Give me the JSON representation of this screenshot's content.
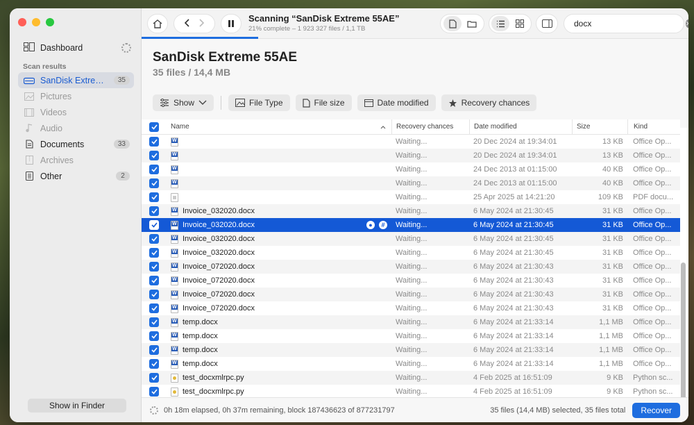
{
  "sidebar": {
    "dashboard_label": "Dashboard",
    "section_label": "Scan results",
    "items": [
      {
        "label": "SanDisk Extreme 5...",
        "count": "35",
        "icon": "drive-icon",
        "state": "active"
      },
      {
        "label": "Pictures",
        "count": "",
        "icon": "picture-icon",
        "state": "dim"
      },
      {
        "label": "Videos",
        "count": "",
        "icon": "video-icon",
        "state": "dim"
      },
      {
        "label": "Audio",
        "count": "",
        "icon": "music-icon",
        "state": "dim"
      },
      {
        "label": "Documents",
        "count": "33",
        "icon": "document-icon",
        "state": "normal"
      },
      {
        "label": "Archives",
        "count": "",
        "icon": "archive-icon",
        "state": "dim"
      },
      {
        "label": "Other",
        "count": "2",
        "icon": "other-file-icon",
        "state": "normal"
      }
    ],
    "finder_button": "Show in Finder"
  },
  "toolbar": {
    "scan_title": "Scanning “SanDisk Extreme 55AE”",
    "scan_subtitle": "21% complete – 1 923 327 files / 1,1 TB",
    "progress": 0.21,
    "search_value": "docx"
  },
  "header": {
    "title": "SanDisk Extreme 55AE",
    "subtitle": "35 files / 14,4 MB",
    "filters": {
      "show": "Show",
      "file_type": "File Type",
      "file_size": "File size",
      "date_modified": "Date modified",
      "recovery": "Recovery chances"
    }
  },
  "table": {
    "columns": {
      "name": "Name",
      "recovery": "Recovery chances",
      "date": "Date modified",
      "size": "Size",
      "kind": "Kind"
    },
    "rows": [
      {
        "name": "",
        "recovery": "Waiting...",
        "date": "20 Dec 2024 at 19:34:01",
        "size": "13 KB",
        "kind": "Office Op...",
        "icon": "w"
      },
      {
        "name": "",
        "recovery": "Waiting...",
        "date": "20 Dec 2024 at 19:34:01",
        "size": "13 KB",
        "kind": "Office Op...",
        "icon": "w"
      },
      {
        "name": "",
        "recovery": "Waiting...",
        "date": "24 Dec 2013 at 01:15:00",
        "size": "40 KB",
        "kind": "Office Op...",
        "icon": "w"
      },
      {
        "name": "",
        "recovery": "Waiting...",
        "date": "24 Dec 2013 at 01:15:00",
        "size": "40 KB",
        "kind": "Office Op...",
        "icon": "w"
      },
      {
        "name": "",
        "recovery": "Waiting...",
        "date": "25 Apr 2025 at 14:21:20",
        "size": "109 KB",
        "kind": "PDF docu...",
        "icon": "f"
      },
      {
        "name": "Invoice_032020.docx",
        "recovery": "Waiting...",
        "date": "6 May 2024 at 21:30:45",
        "size": "31 KB",
        "kind": "Office Op...",
        "icon": "w"
      },
      {
        "name": "Invoice_032020.docx",
        "recovery": "Waiting...",
        "date": "6 May 2024 at 21:30:45",
        "size": "31 KB",
        "kind": "Office Op...",
        "icon": "w",
        "selected": true
      },
      {
        "name": "Invoice_032020.docx",
        "recovery": "Waiting...",
        "date": "6 May 2024 at 21:30:45",
        "size": "31 KB",
        "kind": "Office Op...",
        "icon": "w"
      },
      {
        "name": "Invoice_032020.docx",
        "recovery": "Waiting...",
        "date": "6 May 2024 at 21:30:45",
        "size": "31 KB",
        "kind": "Office Op...",
        "icon": "w"
      },
      {
        "name": "Invoice_072020.docx",
        "recovery": "Waiting...",
        "date": "6 May 2024 at 21:30:43",
        "size": "31 KB",
        "kind": "Office Op...",
        "icon": "w"
      },
      {
        "name": "Invoice_072020.docx",
        "recovery": "Waiting...",
        "date": "6 May 2024 at 21:30:43",
        "size": "31 KB",
        "kind": "Office Op...",
        "icon": "w"
      },
      {
        "name": "Invoice_072020.docx",
        "recovery": "Waiting...",
        "date": "6 May 2024 at 21:30:43",
        "size": "31 KB",
        "kind": "Office Op...",
        "icon": "w"
      },
      {
        "name": "Invoice_072020.docx",
        "recovery": "Waiting...",
        "date": "6 May 2024 at 21:30:43",
        "size": "31 KB",
        "kind": "Office Op...",
        "icon": "w"
      },
      {
        "name": "temp.docx",
        "recovery": "Waiting...",
        "date": "6 May 2024 at 21:33:14",
        "size": "1,1 MB",
        "kind": "Office Op...",
        "icon": "w"
      },
      {
        "name": "temp.docx",
        "recovery": "Waiting...",
        "date": "6 May 2024 at 21:33:14",
        "size": "1,1 MB",
        "kind": "Office Op...",
        "icon": "w"
      },
      {
        "name": "temp.docx",
        "recovery": "Waiting...",
        "date": "6 May 2024 at 21:33:14",
        "size": "1,1 MB",
        "kind": "Office Op...",
        "icon": "w"
      },
      {
        "name": "temp.docx",
        "recovery": "Waiting...",
        "date": "6 May 2024 at 21:33:14",
        "size": "1,1 MB",
        "kind": "Office Op...",
        "icon": "w"
      },
      {
        "name": "test_docxmlrpc.py",
        "recovery": "Waiting...",
        "date": "4 Feb 2025 at 16:51:09",
        "size": "9 KB",
        "kind": "Python sc...",
        "icon": "p"
      },
      {
        "name": "test_docxmlrpc.py",
        "recovery": "Waiting...",
        "date": "4 Feb 2025 at 16:51:09",
        "size": "9 KB",
        "kind": "Python sc...",
        "icon": "p"
      }
    ]
  },
  "status": {
    "elapsed": "0h 18m elapsed, 0h 37m remaining, block 187436623 of 877231797",
    "selection": "35 files (14,4 MB) selected, 35 files total",
    "recover_button": "Recover"
  },
  "colors": {
    "accent": "#1e6ddf",
    "selected_row": "#1459d6"
  }
}
